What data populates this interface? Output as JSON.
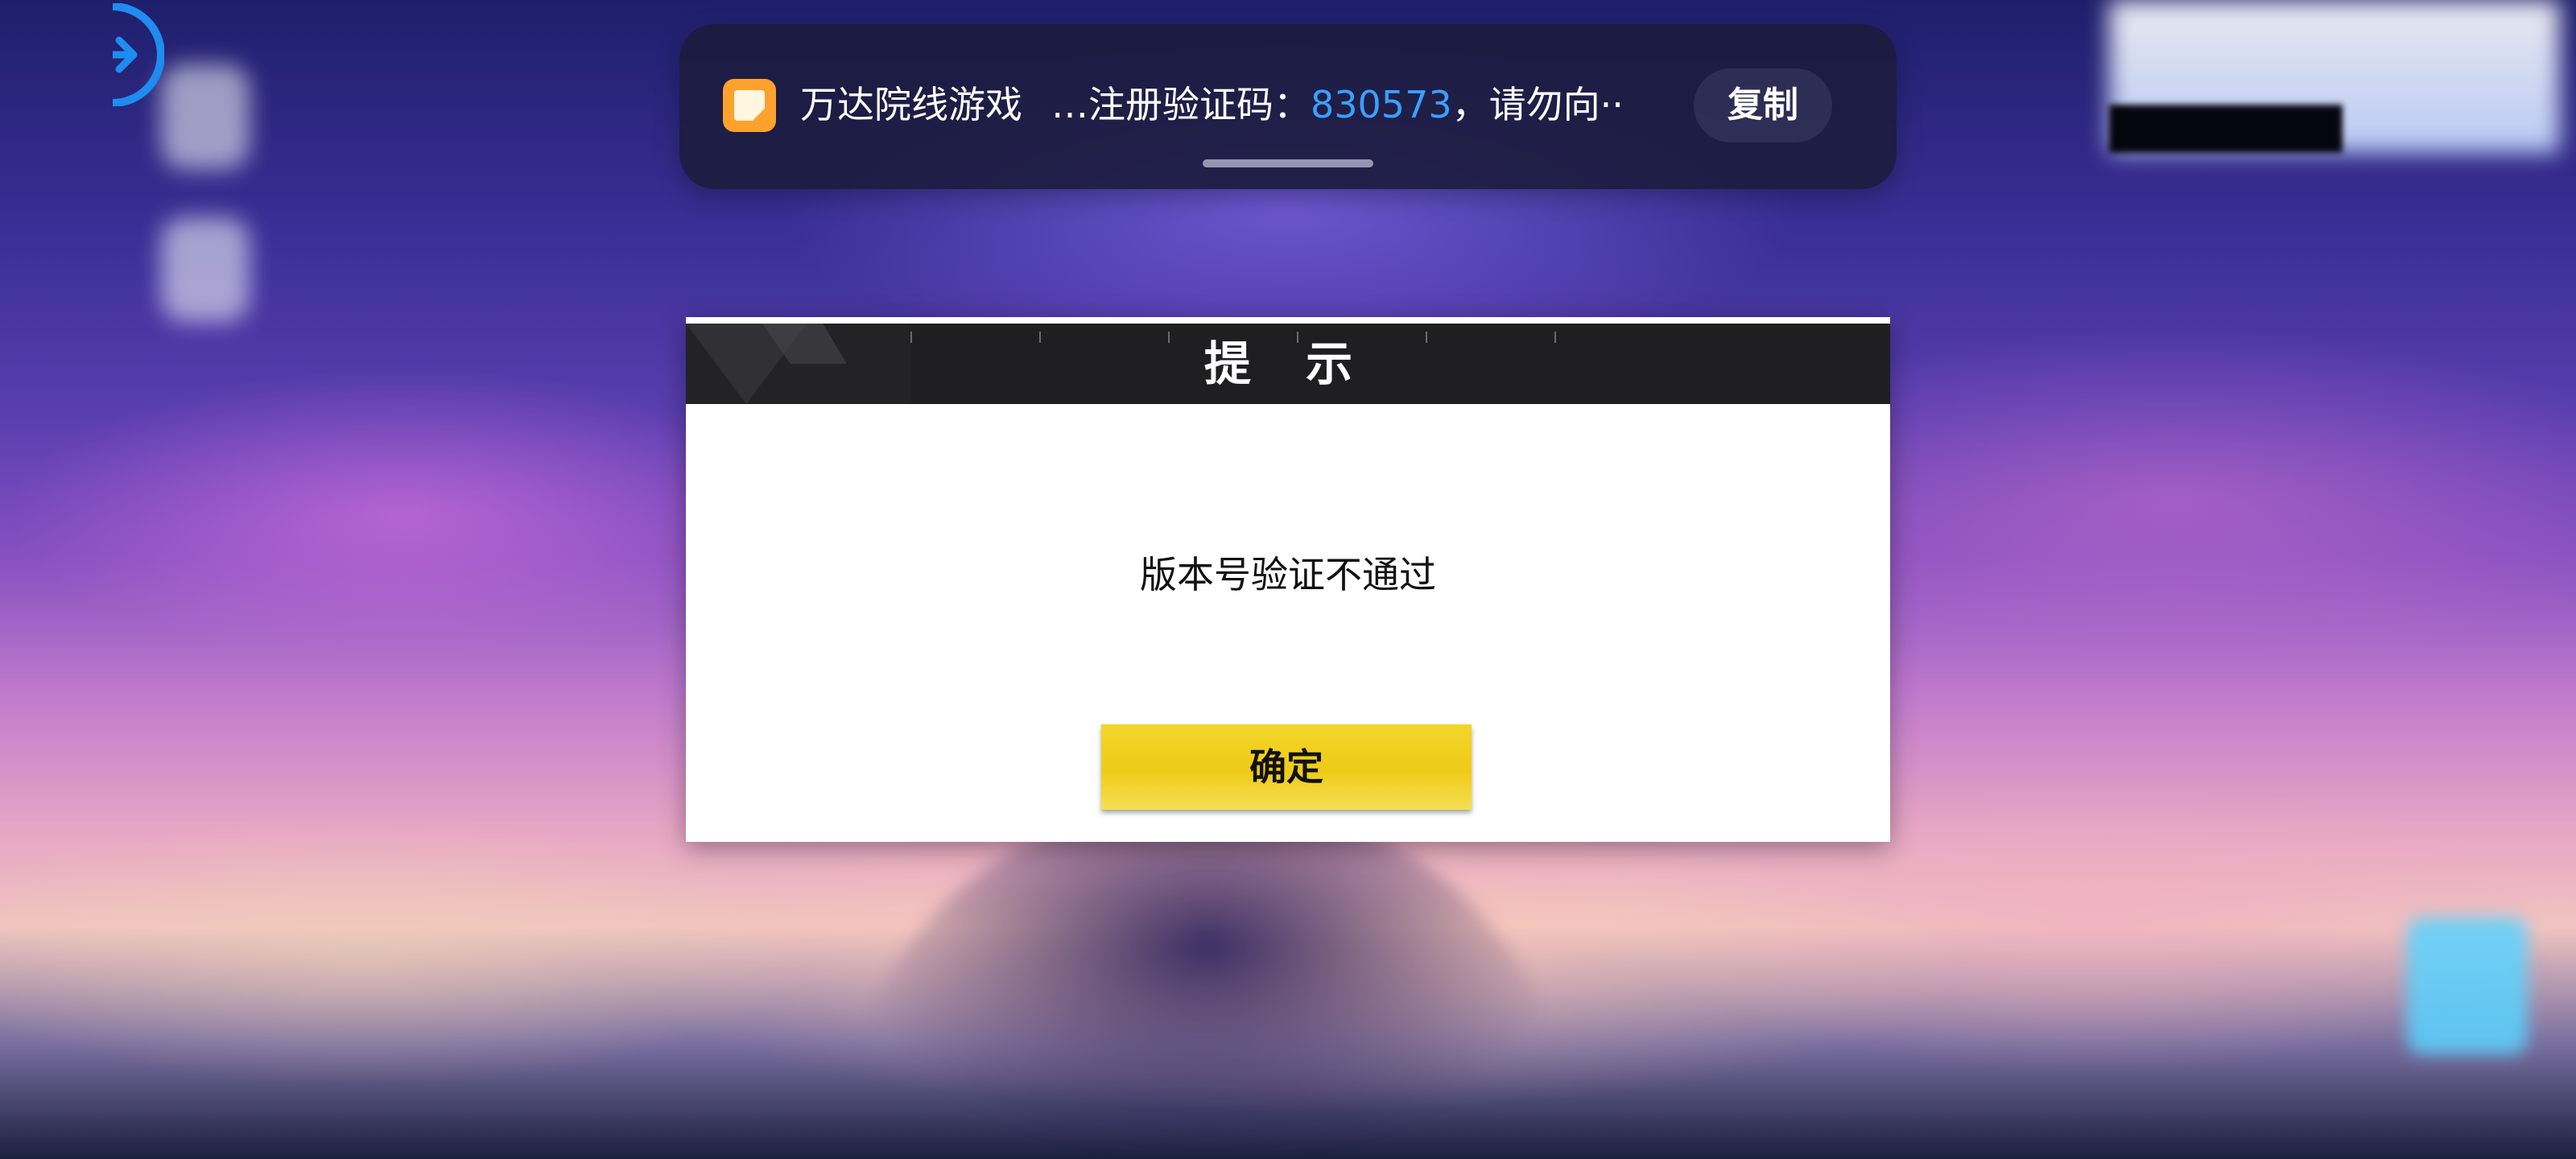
{
  "notification": {
    "app_name": "万达院线游戏",
    "message_prefix": "…注册验证码：",
    "code": "830573",
    "message_suffix": "，请勿向··",
    "copy_label": "复制",
    "app_icon": "app-icon",
    "code_color": "#3aa0ff"
  },
  "nav": {
    "back_icon": "back-arrow-icon"
  },
  "dialog": {
    "title": "提 示",
    "message": "版本号验证不通过",
    "confirm_label": "确定",
    "button_color": "#f0cc1c",
    "header_color": "#1f1f22"
  }
}
